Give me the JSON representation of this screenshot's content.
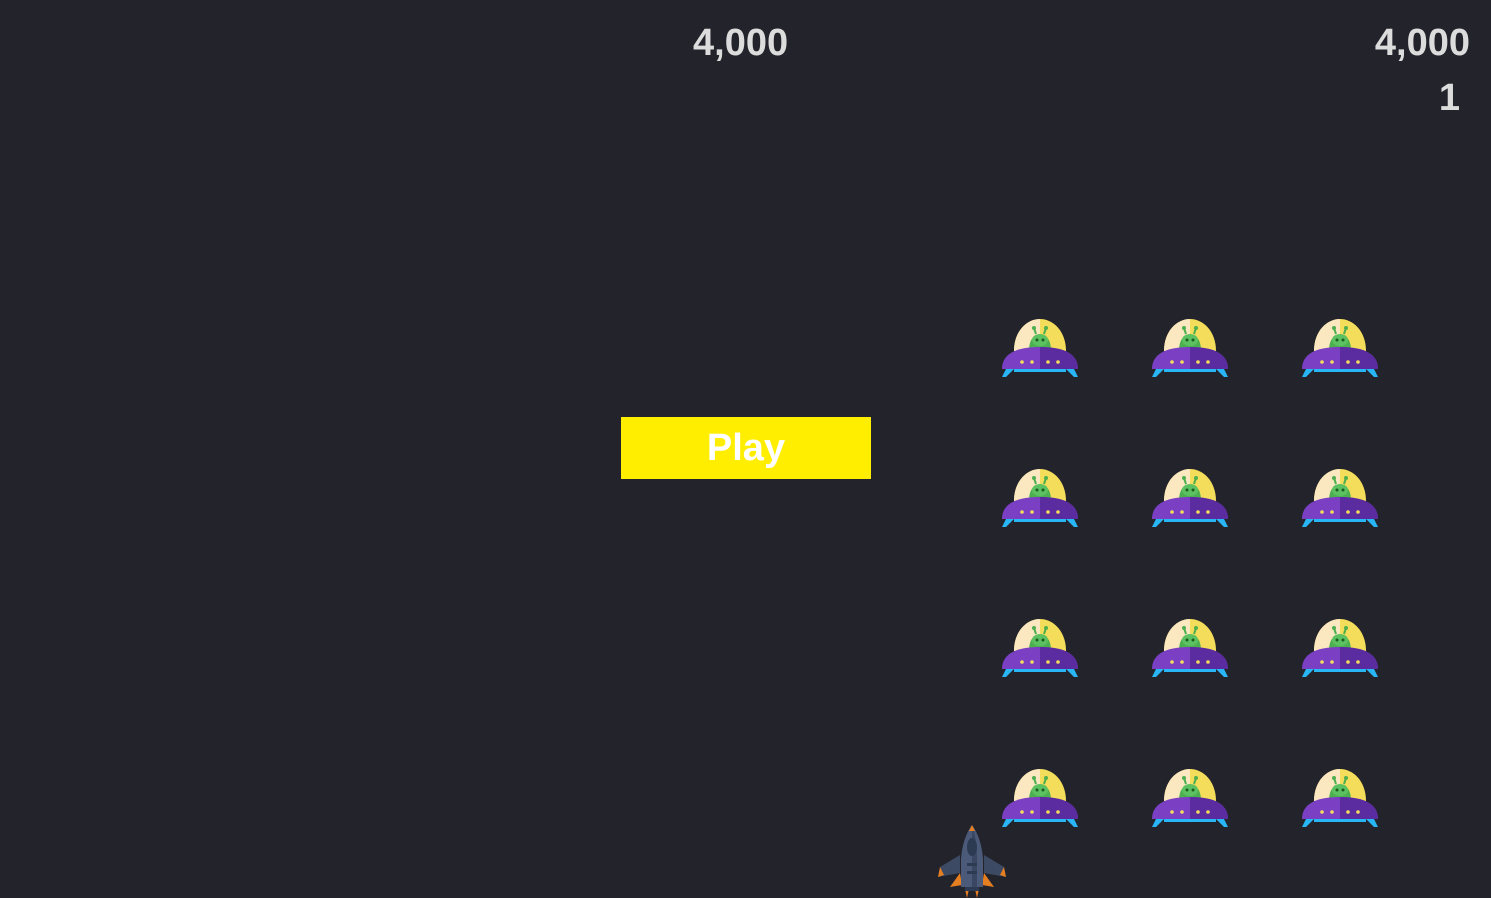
{
  "hud": {
    "score": "4,000",
    "high_score": "4,000",
    "level": "1"
  },
  "play_button": {
    "label": "Play",
    "color": "#ffee00",
    "text_color": "#ffffff"
  },
  "background_color": "#23232b",
  "aliens": {
    "rows": 4,
    "columns": 3,
    "icon": "ufo-alien-icon",
    "count": 12
  },
  "player": {
    "icon": "spaceship-icon",
    "count": 1
  }
}
